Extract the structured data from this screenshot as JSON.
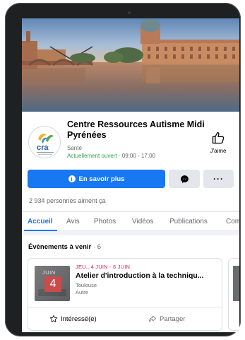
{
  "cover": {
    "description_icon": "cover-photo"
  },
  "page": {
    "name": "Centre Ressources Autisme Midi Pyrénées",
    "category": "Santé",
    "status_open": "Actuellement ouvert",
    "hours": " · 09:00 - 17:00",
    "logo_text": "cra",
    "like_label": "J'aime"
  },
  "actions": {
    "primary_label": "En savoir plus",
    "primary_icon": "info-icon",
    "messenger_icon": "messenger-icon",
    "more_label": "···"
  },
  "likes": {
    "text": "2 934 personnes aiment ça"
  },
  "tabs": [
    {
      "label": "Accueil",
      "active": true
    },
    {
      "label": "Avis"
    },
    {
      "label": "Photos"
    },
    {
      "label": "Vidéos"
    },
    {
      "label": "Publications"
    },
    {
      "label": "Com"
    }
  ],
  "events": {
    "title": "Évènements à venir",
    "count": " · 6",
    "items": [
      {
        "date": "JEU., 4 JUIN - 6 JUIN",
        "title": "Atelier d'introduction à la techniqu...",
        "place": "Toulouse",
        "place2": "Autre",
        "cal_month": "JUIN",
        "cal_day": "4",
        "interested_label": "Intéressé(e)",
        "share_label": "Partager"
      }
    ]
  },
  "colors": {
    "accent": "#1877f2",
    "open": "#31a24c",
    "event_date": "#e41e3f"
  }
}
